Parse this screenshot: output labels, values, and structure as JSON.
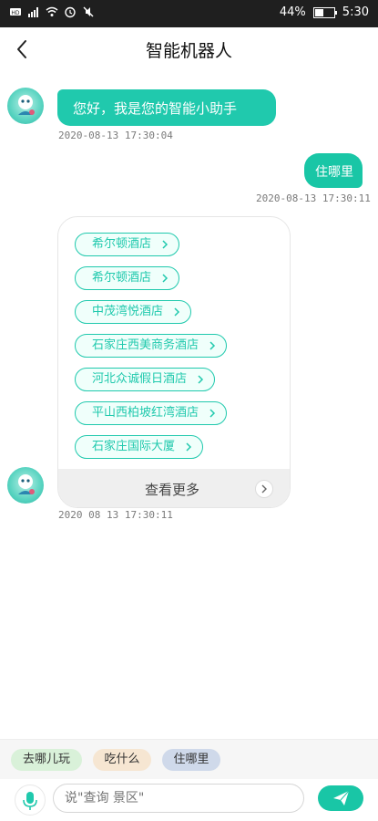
{
  "status": {
    "battery": "44%",
    "battery_level": 0.44,
    "time": "5:30"
  },
  "header": {
    "title": "智能机器人"
  },
  "messages": {
    "greeting": {
      "text": "您好，我是您的智能小助手",
      "time": "2020-08-13 17:30:04"
    },
    "user": {
      "text": "住哪里",
      "time": "2020-08-13 17:30:11"
    },
    "results": {
      "items": [
        "希尔顿酒店",
        "希尔顿酒店",
        "中茂湾悦酒店",
        "石家庄西美商务酒店",
        "河北众诚假日酒店",
        "平山西柏坡红湾酒店",
        "石家庄国际大厦"
      ],
      "more_label": "查看更多",
      "time": "2020 08 13 17:30:11"
    }
  },
  "quick_replies": [
    {
      "label": "去哪儿玩",
      "color": "#d9f1d9",
      "text_color": "#333333"
    },
    {
      "label": "吃什么",
      "color": "#f6e6d2",
      "text_color": "#333333"
    },
    {
      "label": "住哪里",
      "color": "#cfd9ea",
      "text_color": "#333333"
    }
  ],
  "input": {
    "placeholder": "说\"查询 景区\""
  },
  "colors": {
    "accent": "#20c9ad"
  },
  "icons": {
    "back": "chevron-left-icon",
    "send": "paper-plane-icon",
    "mic": "microphone-icon",
    "more": "chevron-right-icon"
  }
}
